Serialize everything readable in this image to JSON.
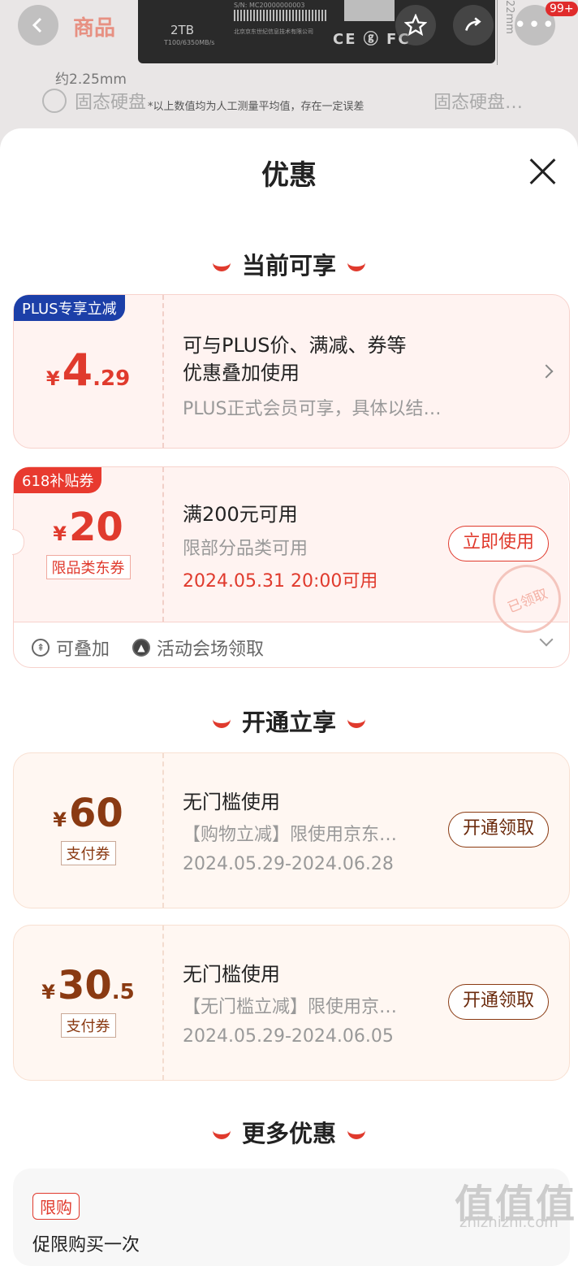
{
  "background": {
    "tab_label": "商品",
    "cart_badge": "99+",
    "ssd_capacity": "2TB",
    "ssd_speed": "T100/6350MB/s",
    "ssd_sn": "S/N: MC20000000003",
    "ssd_maker": "北京京东世纪信息技术有限公司",
    "ssd_marks": "CE ⓖ FC",
    "size_label": "约2.25mm",
    "dim_label": "22mm",
    "search_left": "固态硬盘",
    "search_right": "固态硬盘…",
    "note": "*以上数值均为人工测量平均值，存在一定误差"
  },
  "sheet": {
    "title": "优惠",
    "section_current": "当前可享",
    "section_open": "开通立享",
    "section_more": "更多优惠"
  },
  "cards": {
    "plus": {
      "tag": "PLUS专享立减",
      "yen": "¥",
      "int": "4",
      "dec": ".29",
      "title": "可与PLUS价、满减、券等",
      "title2": "优惠叠加使用",
      "desc": "PLUS正式会员可享，具体以结…"
    },
    "subsidy": {
      "tag": "618补贴券",
      "yen": "¥",
      "int": "20",
      "type": "限品类东券",
      "title": "满200元可用",
      "desc": "限部分品类可用",
      "time": "2024.05.31 20:00可用",
      "button": "立即使用",
      "stamp": "已领取",
      "foot1": "可叠加",
      "foot2": "活动会场领取"
    },
    "pay60": {
      "yen": "¥",
      "int": "60",
      "type": "支付券",
      "title": "无门槛使用",
      "desc": "【购物立减】限使用京东…",
      "time": "2024.05.29-2024.06.28",
      "button": "开通领取"
    },
    "pay30": {
      "yen": "¥",
      "int": "30",
      "dec": ".5",
      "type": "支付券",
      "title": "无门槛使用",
      "desc": "【无门槛立减】限使用京…",
      "time": "2024.05.29-2024.06.05",
      "button": "开通领取"
    }
  },
  "more": {
    "tag": "限购",
    "text": "促限购买一次",
    "watermark": "值值值",
    "watermark_sub": "zhizhizhi.com"
  },
  "colors": {
    "accent": "#e03a2d",
    "plus_blue": "#1c3fa8",
    "brown": "#8a3a12"
  }
}
